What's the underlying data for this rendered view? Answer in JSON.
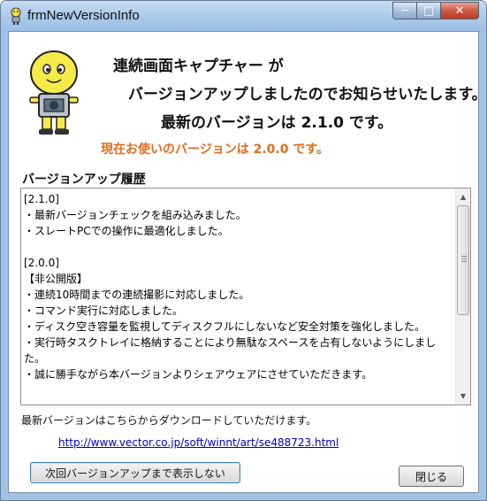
{
  "window": {
    "title": "frmNewVersionInfo",
    "controls": {
      "minimize": "─",
      "maximize": "□",
      "close": "✕"
    }
  },
  "message": {
    "line1": "連続画面キャプチャー が",
    "line2": "バージョンアップしましたのでお知らせいたします。",
    "line3": "最新のバージョンは 2.1.0 です。",
    "current_version": "現在お使いのバージョンは 2.0.0 です。"
  },
  "history": {
    "label": "バージョンアップ履歴",
    "lines": [
      "[2.1.0]",
      "・最新バージョンチェックを組み込みました。",
      "・スレートPCでの操作に最適化しました。",
      "",
      "[2.0.0]",
      "【非公開版】",
      "・連続10時間までの連続撮影に対応しました。",
      "・コマンド実行に対応しました。",
      "・ディスク空き容量を監視してディスクフルにしないなど安全対策を強化しました。",
      "・実行時タスクトレイに格納することにより無駄なスペースを占有しないようにしまし",
      "た。",
      "・誠に勝手ながら本バージョンよりシェアウェアにさせていただきます。"
    ]
  },
  "download": {
    "text": "最新バージョンはこちらからダウンロードしていただけます。",
    "url": "http://www.vector.co.jp/soft/winnt/art/se488723.html"
  },
  "buttons": {
    "skip": "次回バージョンアップまで表示しない",
    "close": "閉じる"
  },
  "colors": {
    "current_version": "#e46c1d",
    "link": "#0000cc",
    "title_bar": "#a9c9ea",
    "close_button": "#c94a33"
  },
  "icons": {
    "app": "app-icon",
    "mascot": "mascot-icon",
    "scroll_up": "scroll-up-icon",
    "scroll_down": "scroll-down-icon"
  }
}
